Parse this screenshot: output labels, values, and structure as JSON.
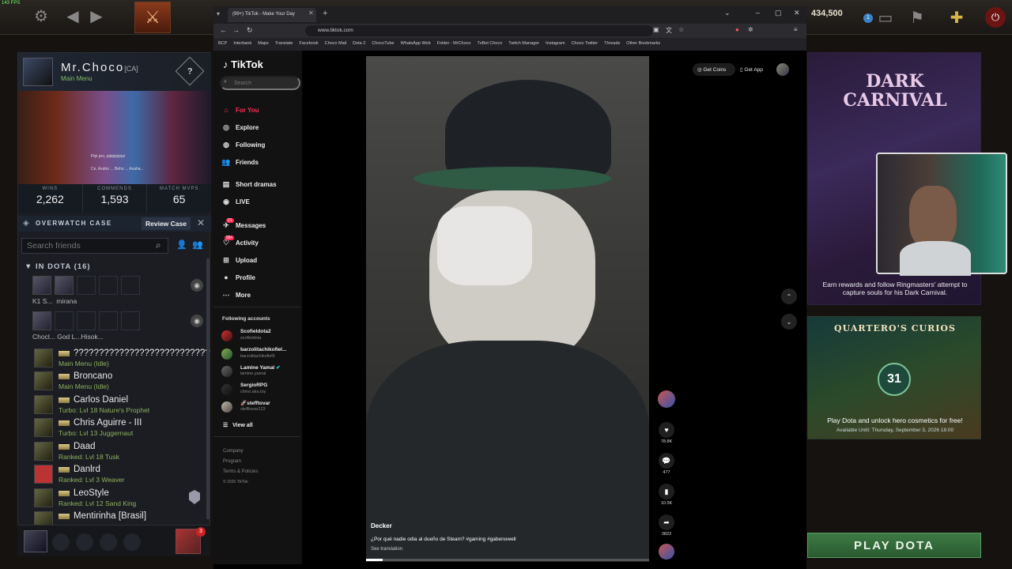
{
  "fps": "143 FPS",
  "dota_top": {
    "shards": "434,500",
    "notification_count": "1"
  },
  "profile": {
    "name": "Mr.Choco",
    "tag": "[CA]",
    "status": "Main Menu",
    "hero_caption_1": "Pipi pro, pipipipipipi",
    "hero_caption_2": "Ce, Asaho ... Beho ... Asaha..."
  },
  "stats": [
    {
      "label": "WINS",
      "value": "2,262"
    },
    {
      "label": "COMMENDS",
      "value": "1,593"
    },
    {
      "label": "MATCH MVPS",
      "value": "65"
    }
  ],
  "overwatch": {
    "label": "OVERWATCH CASE",
    "button": "Review Case"
  },
  "friends_search": {
    "placeholder": "Search friends"
  },
  "in_dota": {
    "header": "IN DOTA (16)"
  },
  "parties": [
    {
      "name": "K1 S...",
      "name2": "mirana"
    },
    {
      "name": "Chocl...",
      "name2": "God L...Hisok..."
    }
  ],
  "friends": [
    {
      "name": "???????????????????????????",
      "status": "Main Menu (Idle)"
    },
    {
      "name": "Broncano",
      "status": "Main Menu (Idle)"
    },
    {
      "name": "Carlos Daniel",
      "status": "Turbo: Lvl 18 Nature's Prophet"
    },
    {
      "name": "Chris Aguirre - III",
      "status": "Turbo: Lvl 13 Juggernaut"
    },
    {
      "name": "Daad",
      "status": "Ranked: Lvl 18 Tusk"
    },
    {
      "name": "Danlrd",
      "status": "Ranked: Lvl 3 Weaver"
    },
    {
      "name": "LeoStyle",
      "status": "Ranked: Lvl 12 Sand King"
    },
    {
      "name": "Mentirinha [Brasil]",
      "status": ""
    }
  ],
  "chat_badge": "3",
  "browser": {
    "tab_title": "(99+) TikTok - Make Your Day",
    "url": "www.tiktok.com",
    "bookmarks": [
      "BCP",
      "Interbank",
      "Maps",
      "Translate",
      "Facebook",
      "Choco Mail",
      "Dota 2",
      "ChocoTube",
      "WhatsApp Web",
      "Folder - MrChoco",
      "TxBet Choco",
      "Twitch Manager",
      "Instagram",
      "Choco Twitter",
      "Threads",
      "Other Bookmarks"
    ]
  },
  "tiktok": {
    "logo": "TikTok",
    "search_placeholder": "Search",
    "nav": [
      {
        "label": "For You",
        "icon": "home-icon"
      },
      {
        "label": "Explore",
        "icon": "compass-icon"
      },
      {
        "label": "Following",
        "icon": "following-icon"
      },
      {
        "label": "Friends",
        "icon": "friends-icon"
      },
      {
        "label": "Short dramas",
        "icon": "film-icon"
      },
      {
        "label": "LIVE",
        "icon": "live-icon"
      },
      {
        "label": "Messages",
        "icon": "messages-icon",
        "badge": "21"
      },
      {
        "label": "Activity",
        "icon": "activity-icon",
        "badge": "99+"
      },
      {
        "label": "Upload",
        "icon": "upload-icon"
      },
      {
        "label": "Profile",
        "icon": "profile-icon"
      },
      {
        "label": "More",
        "icon": "more-icon"
      }
    ],
    "following_header": "Following accounts",
    "accounts": [
      {
        "name": "Scofieldota2",
        "handle": "scofieldota"
      },
      {
        "name": "barzolitachikofiel...",
        "handle": "barzolitachikofiel5"
      },
      {
        "name": "Lamine Yamal",
        "handle": "lamine.yamal"
      },
      {
        "name": "SergioRPG",
        "handle": "chino.aka.toy"
      },
      {
        "name": "stefftovar",
        "handle": "stefftovar123"
      }
    ],
    "view_all": "View all",
    "footer": [
      "Company",
      "Program",
      "Terms & Policies",
      "© 2026 TikTok"
    ],
    "get_coins": "Get Coins",
    "get_app": "Get App",
    "video": {
      "author": "Decker",
      "caption": "¿Por qué nadie odia al dueño de Steam? #gaming #gabenowell",
      "see_translation": "See translation"
    },
    "actions": [
      {
        "icon": "heart-icon",
        "count": "78.8K"
      },
      {
        "icon": "comment-icon",
        "count": "477"
      },
      {
        "icon": "bookmark-icon",
        "count": "10.5K"
      },
      {
        "icon": "share-icon",
        "count": "3823"
      }
    ]
  },
  "dark_carnival": {
    "title": "DARK CARNIVAL",
    "desc": "Earn rewards and follow Ringmasters' attempt to capture souls for his Dark Carnival."
  },
  "curios": {
    "title": "QUARTERO'S CURIOS",
    "days": "31",
    "desc": "Play Dota and unlock hero cosmetics for free!",
    "available": "Available Until: Thursday, September 3, 2026 18:00"
  },
  "play_button": "PLAY DOTA"
}
